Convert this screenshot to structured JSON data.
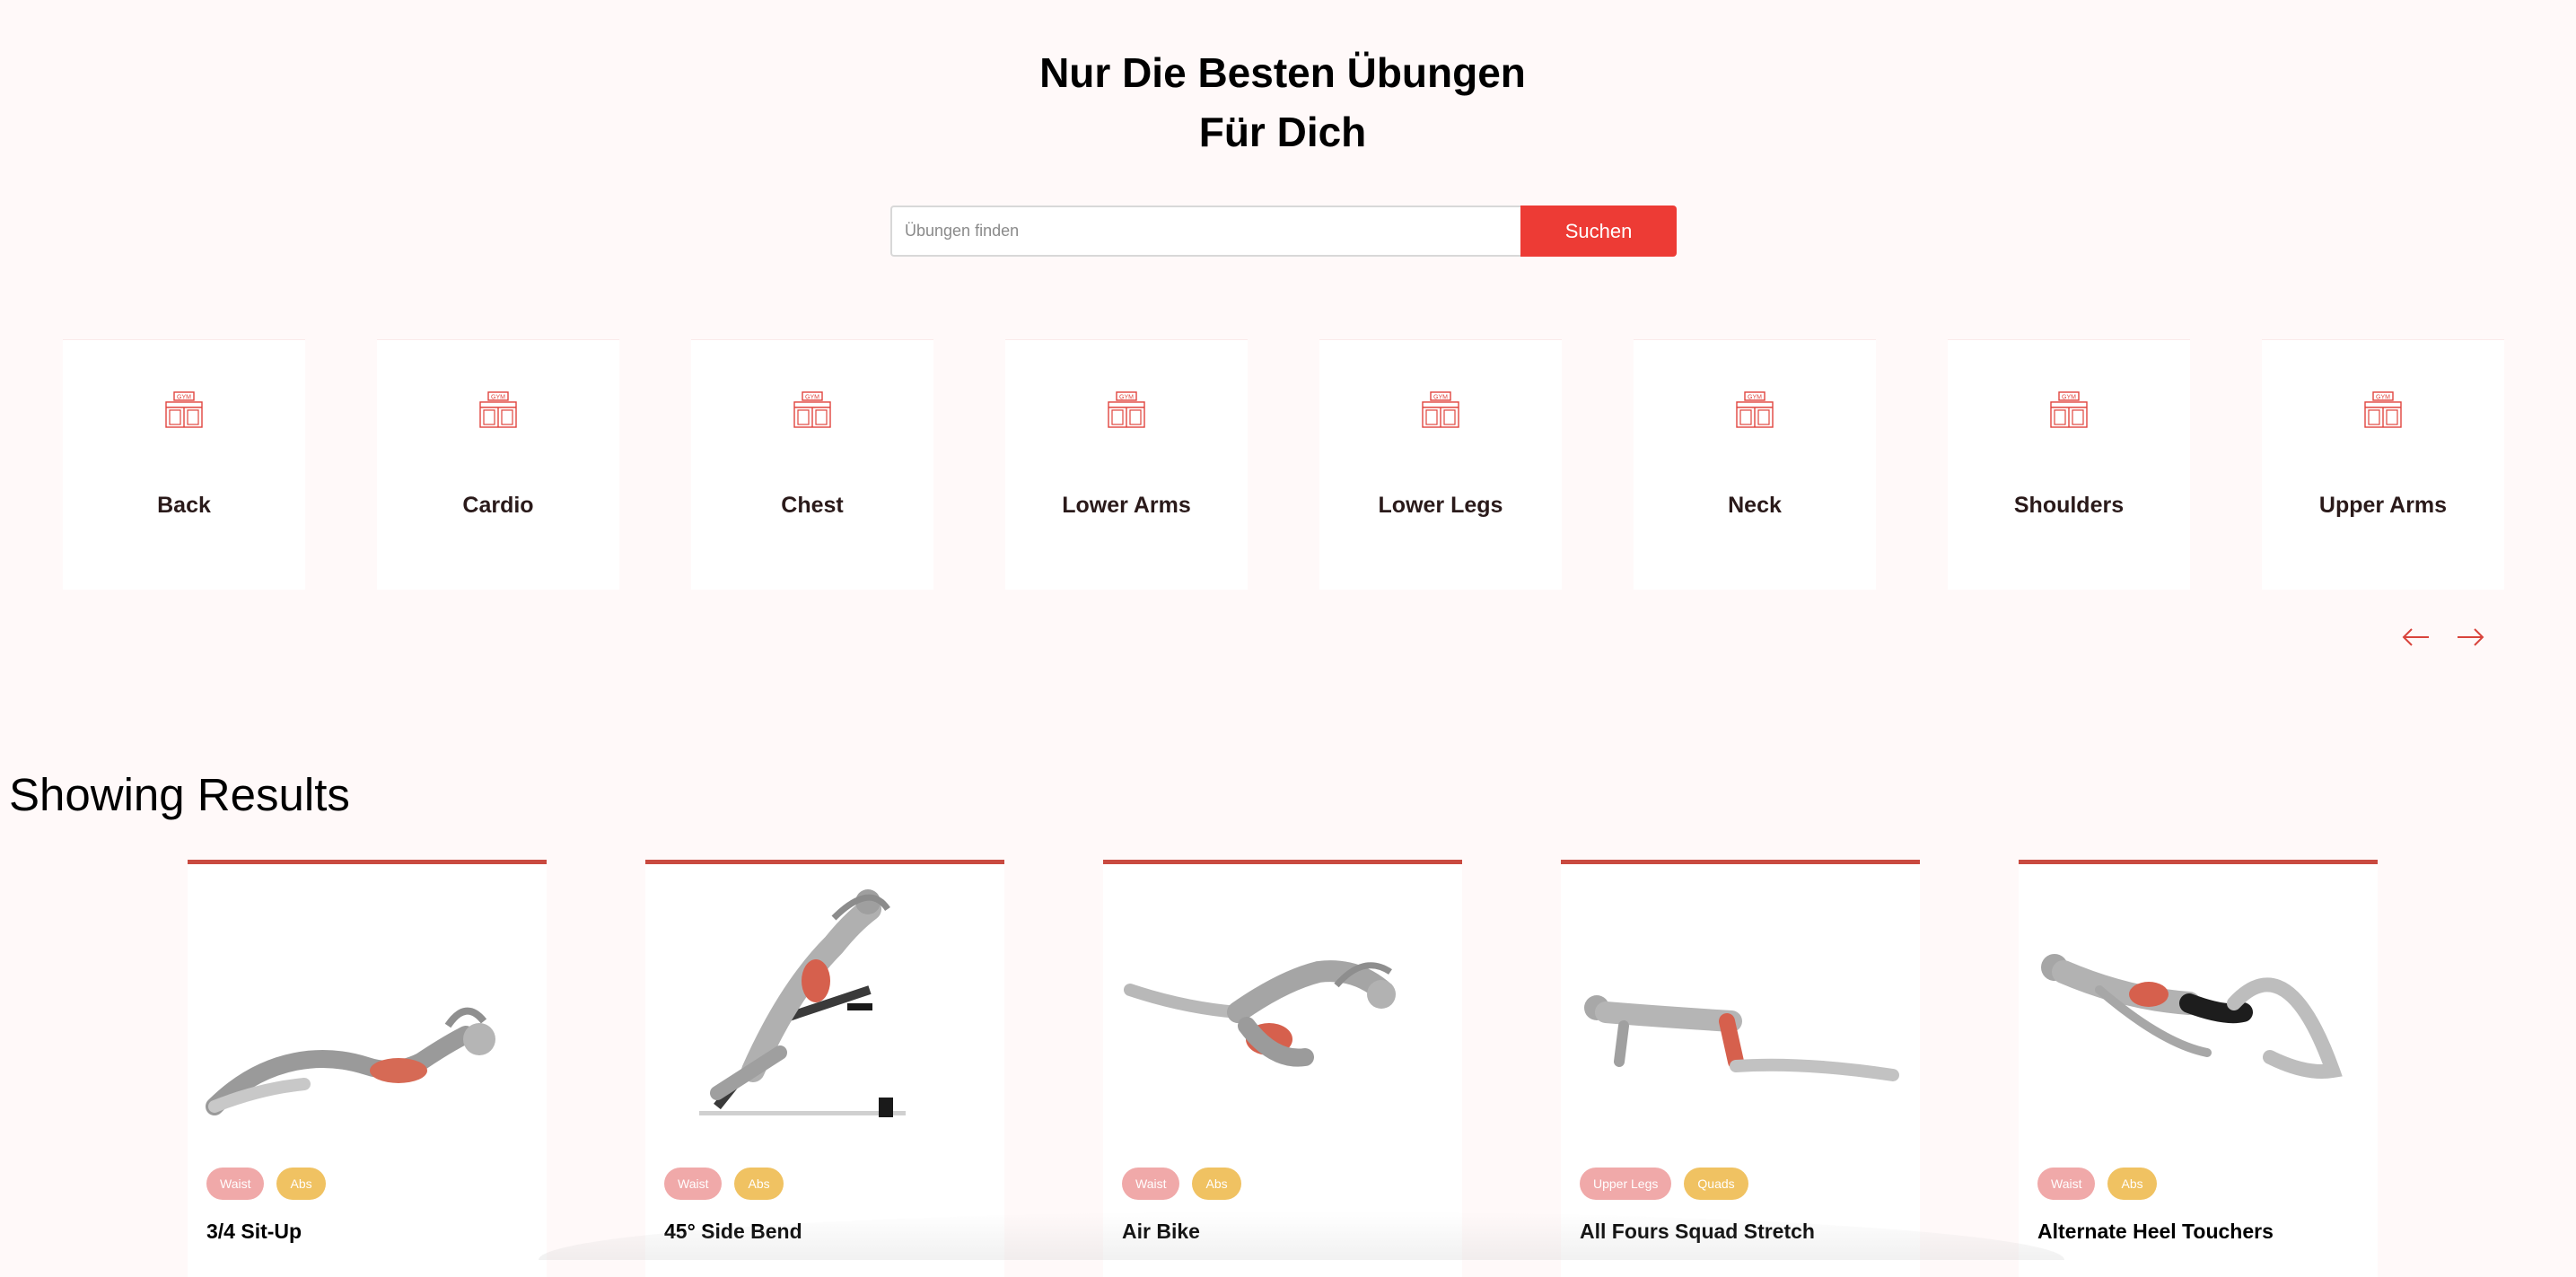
{
  "hero": {
    "line1": "Nur Die Besten Übungen",
    "line2": "Für Dich"
  },
  "search": {
    "placeholder": "Übungen finden",
    "value": "",
    "button_label": "Suchen"
  },
  "categories": [
    {
      "label": "Back",
      "icon": "gym-icon"
    },
    {
      "label": "Cardio",
      "icon": "gym-icon"
    },
    {
      "label": "Chest",
      "icon": "gym-icon"
    },
    {
      "label": "Lower Arms",
      "icon": "gym-icon"
    },
    {
      "label": "Lower Legs",
      "icon": "gym-icon"
    },
    {
      "label": "Neck",
      "icon": "gym-icon"
    },
    {
      "label": "Shoulders",
      "icon": "gym-icon"
    },
    {
      "label": "Upper Arms",
      "icon": "gym-icon"
    }
  ],
  "category_icon_text": "GYM",
  "nav": {
    "prev_icon": "arrow-left-icon",
    "next_icon": "arrow-right-icon"
  },
  "results": {
    "title": "Showing Results",
    "exercises": [
      {
        "name": "3/4 Sit-Up",
        "tags": [
          "Waist",
          "Abs"
        ]
      },
      {
        "name": "45° Side Bend",
        "tags": [
          "Waist",
          "Abs"
        ]
      },
      {
        "name": "Air Bike",
        "tags": [
          "Waist",
          "Abs"
        ]
      },
      {
        "name": "All Fours Squad Stretch",
        "tags": [
          "Upper Legs",
          "Quads"
        ]
      },
      {
        "name": "Alternate Heel Touchers",
        "tags": [
          "Waist",
          "Abs"
        ]
      }
    ]
  },
  "colors": {
    "accent": "#ed3b35",
    "card_border": "#c94a40",
    "tag_primary": "#f0a9a9",
    "tag_secondary": "#f0c262",
    "page_bg": "#fff9f9"
  }
}
